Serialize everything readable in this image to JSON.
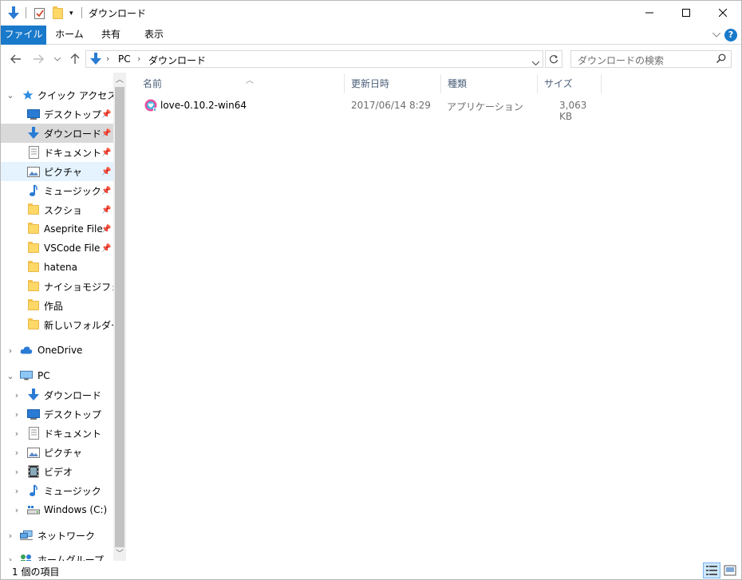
{
  "titlebar": {
    "title": "ダウンロード",
    "minimize": "—",
    "maximize": "☐",
    "close": "✕"
  },
  "ribbon": {
    "tabs": [
      {
        "label": "ファイル"
      },
      {
        "label": "ホーム"
      },
      {
        "label": "共有"
      },
      {
        "label": "表示"
      }
    ],
    "help": "?"
  },
  "address": {
    "crumbs": [
      "PC",
      "ダウンロード"
    ],
    "search_placeholder": "ダウンロードの検索"
  },
  "nav": {
    "quick_access": "クイック アクセス",
    "quick_items": [
      {
        "label": "デスクトップ"
      },
      {
        "label": "ダウンロード"
      },
      {
        "label": "ドキュメント"
      },
      {
        "label": "ピクチャ"
      },
      {
        "label": "ミュージック"
      },
      {
        "label": "スクショ"
      },
      {
        "label": "Aseprite File"
      },
      {
        "label": "VSCode File"
      },
      {
        "label": "hatena"
      },
      {
        "label": "ナイショモジフォント"
      },
      {
        "label": "作品"
      },
      {
        "label": "新しいフォルダー"
      }
    ],
    "onedrive": "OneDrive",
    "pc": "PC",
    "pc_items": [
      {
        "label": "ダウンロード"
      },
      {
        "label": "デスクトップ"
      },
      {
        "label": "ドキュメント"
      },
      {
        "label": "ピクチャ"
      },
      {
        "label": "ビデオ"
      },
      {
        "label": "ミュージック"
      },
      {
        "label": "Windows (C:)"
      }
    ],
    "network": "ネットワーク",
    "homegroup": "ホームグループ"
  },
  "columns": {
    "name": "名前",
    "modified": "更新日時",
    "type": "種類",
    "size": "サイズ"
  },
  "files": [
    {
      "name": "love-0.10.2-win64",
      "modified": "2017/06/14 8:29",
      "type": "アプリケーション",
      "size": "3,063 KB"
    }
  ],
  "status": {
    "count": "1 個の項目"
  },
  "colors": {
    "accent": "#1979ca",
    "selected": "#d9d9d9",
    "hover": "#e5f3ff"
  }
}
